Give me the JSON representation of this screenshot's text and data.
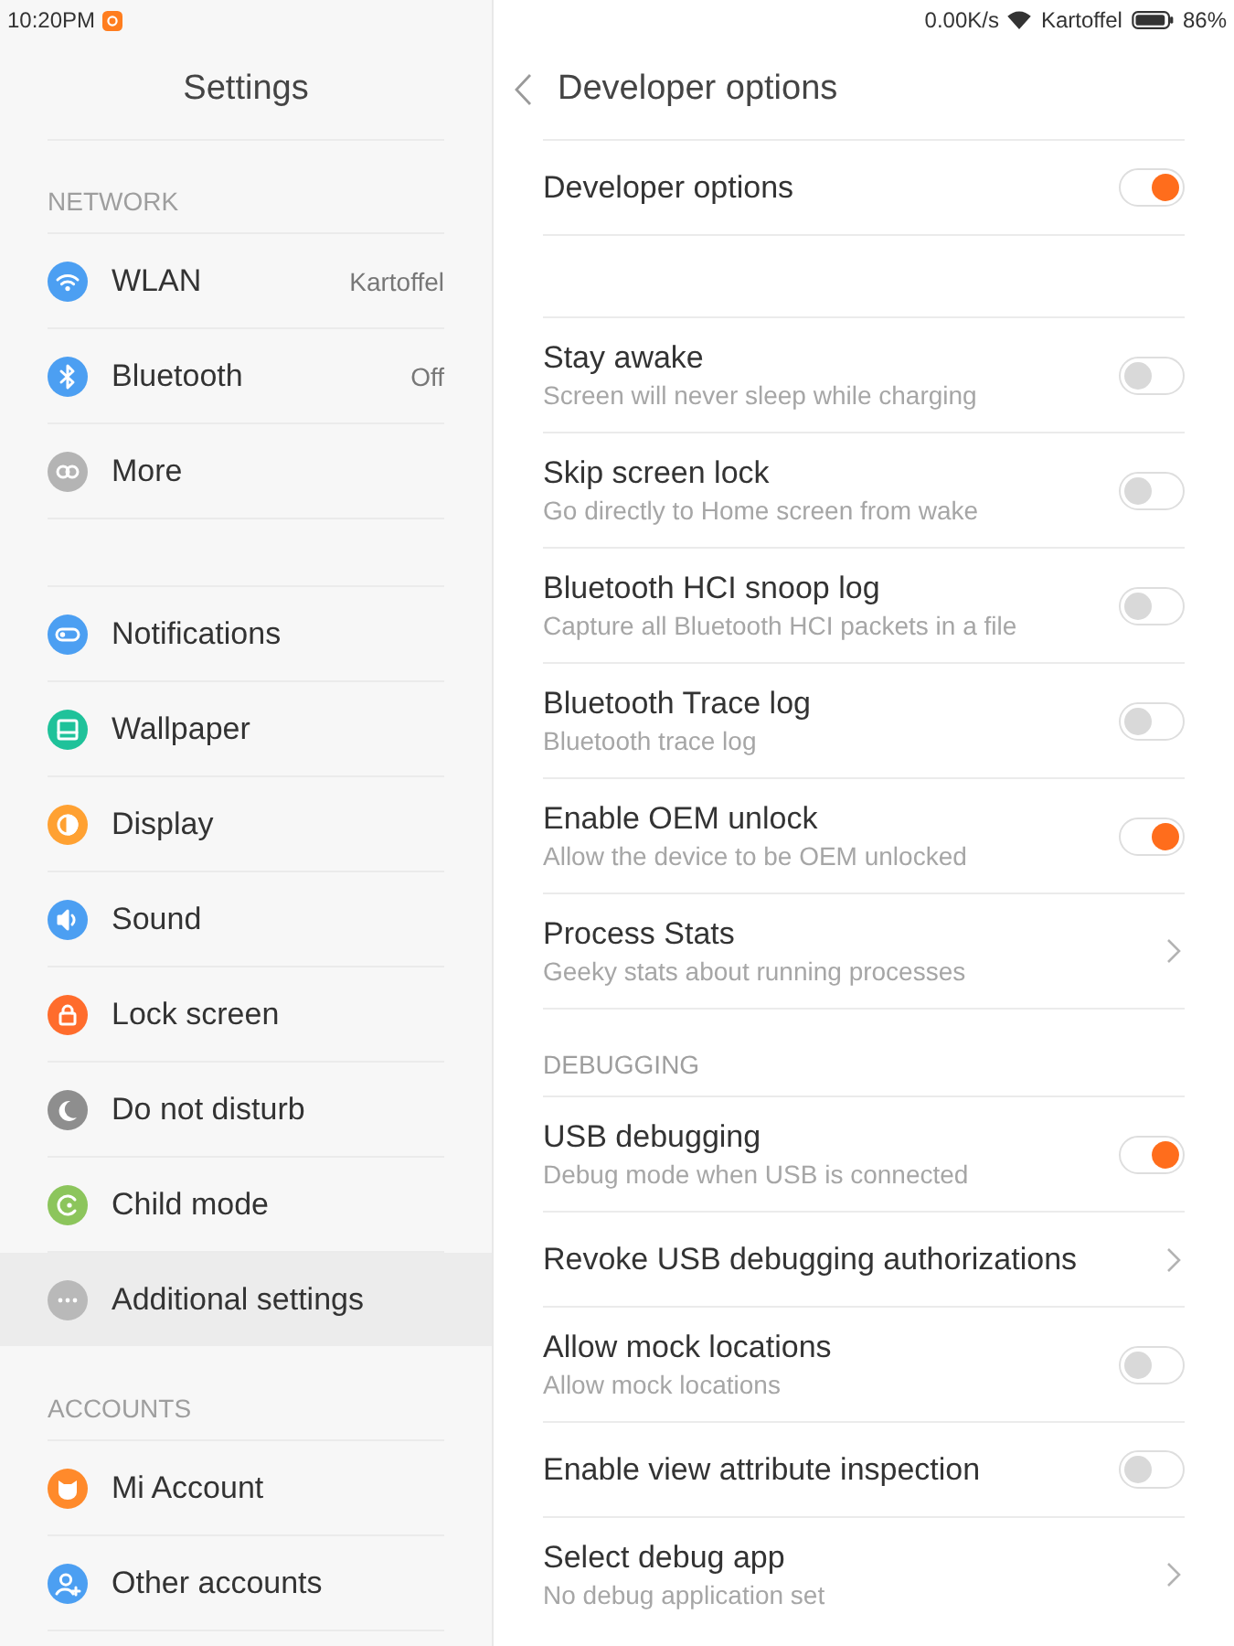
{
  "status_bar": {
    "time": "10:20PM",
    "net_speed": "0.00K/s",
    "network_name": "Kartoffel",
    "battery": "86%"
  },
  "sidebar": {
    "title": "Settings",
    "groups": [
      {
        "header": "NETWORK",
        "items": [
          {
            "label": "WLAN",
            "value": "Kartoffel",
            "selected": false,
            "color": "#4c9ff2"
          },
          {
            "label": "Bluetooth",
            "value": "Off",
            "selected": false,
            "color": "#4c9ff2"
          },
          {
            "label": "More",
            "selected": false,
            "color": "#b4b4b4"
          }
        ]
      },
      {
        "items": [
          {
            "label": "Notifications",
            "selected": false,
            "color": "#4c9ff2"
          },
          {
            "label": "Wallpaper",
            "selected": false,
            "color": "#1fc29a"
          },
          {
            "label": "Display",
            "selected": false,
            "color": "#ffa132"
          },
          {
            "label": "Sound",
            "selected": false,
            "color": "#4c9ff2"
          },
          {
            "label": "Lock screen",
            "selected": false,
            "color": "#ff6c2c"
          },
          {
            "label": "Do not disturb",
            "selected": false,
            "color": "#8e8e8e"
          },
          {
            "label": "Child mode",
            "selected": false,
            "color": "#8cc55c"
          },
          {
            "label": "Additional settings",
            "selected": true,
            "color": "#b9b9b9"
          }
        ]
      },
      {
        "header": "ACCOUNTS",
        "items": [
          {
            "label": "Mi Account",
            "selected": false,
            "color": "#ff8a2b"
          },
          {
            "label": "Other accounts",
            "selected": false,
            "color": "#4c9ff2"
          }
        ]
      }
    ]
  },
  "detail": {
    "title": "Developer options",
    "sections": [
      {
        "items": [
          {
            "kind": "toggle",
            "title": "Developer options",
            "on": true
          }
        ]
      },
      {
        "items": [
          {
            "kind": "toggle",
            "title": "Stay awake",
            "description": "Screen will never sleep while charging",
            "on": false
          },
          {
            "kind": "toggle",
            "title": "Skip screen lock",
            "description": "Go directly to Home screen from wake",
            "on": false
          },
          {
            "kind": "toggle",
            "title": "Bluetooth HCI snoop log",
            "description": "Capture all Bluetooth HCI packets in a file",
            "on": false
          },
          {
            "kind": "toggle",
            "title": "Bluetooth Trace log",
            "description": "Bluetooth trace log",
            "on": false
          },
          {
            "kind": "toggle",
            "title": "Enable OEM unlock",
            "description": "Allow the device to be OEM unlocked",
            "on": true
          },
          {
            "kind": "link",
            "title": "Process Stats",
            "description": "Geeky stats about running processes"
          }
        ]
      },
      {
        "header": "DEBUGGING",
        "items": [
          {
            "kind": "toggle",
            "title": "USB debugging",
            "description": "Debug mode when USB is connected",
            "on": true
          },
          {
            "kind": "link",
            "title": "Revoke USB debugging authorizations"
          },
          {
            "kind": "toggle",
            "title": "Allow mock locations",
            "description": "Allow mock locations",
            "on": false
          },
          {
            "kind": "toggle",
            "title": "Enable view attribute inspection",
            "on": false
          },
          {
            "kind": "link",
            "title": "Select debug app",
            "description": "No debug application set"
          }
        ]
      }
    ]
  }
}
